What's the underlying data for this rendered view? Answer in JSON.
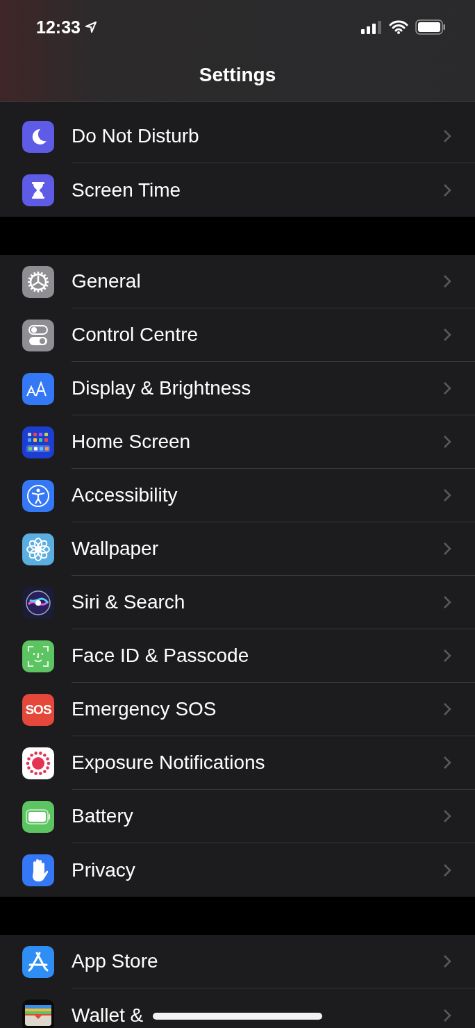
{
  "status_bar": {
    "time": "12:33"
  },
  "nav": {
    "title": "Settings"
  },
  "groups": [
    {
      "items": [
        {
          "label": "Do Not Disturb"
        },
        {
          "label": "Screen Time"
        }
      ]
    },
    {
      "items": [
        {
          "label": "General"
        },
        {
          "label": "Control Centre"
        },
        {
          "label": "Display & Brightness"
        },
        {
          "label": "Home Screen"
        },
        {
          "label": "Accessibility"
        },
        {
          "label": "Wallpaper"
        },
        {
          "label": "Siri & Search"
        },
        {
          "label": "Face ID & Passcode"
        },
        {
          "label": "Emergency SOS",
          "icon_text": "SOS"
        },
        {
          "label": "Exposure Notifications"
        },
        {
          "label": "Battery"
        },
        {
          "label": "Privacy"
        }
      ]
    },
    {
      "items": [
        {
          "label": "App Store"
        },
        {
          "label": "Wallet &"
        }
      ]
    }
  ]
}
